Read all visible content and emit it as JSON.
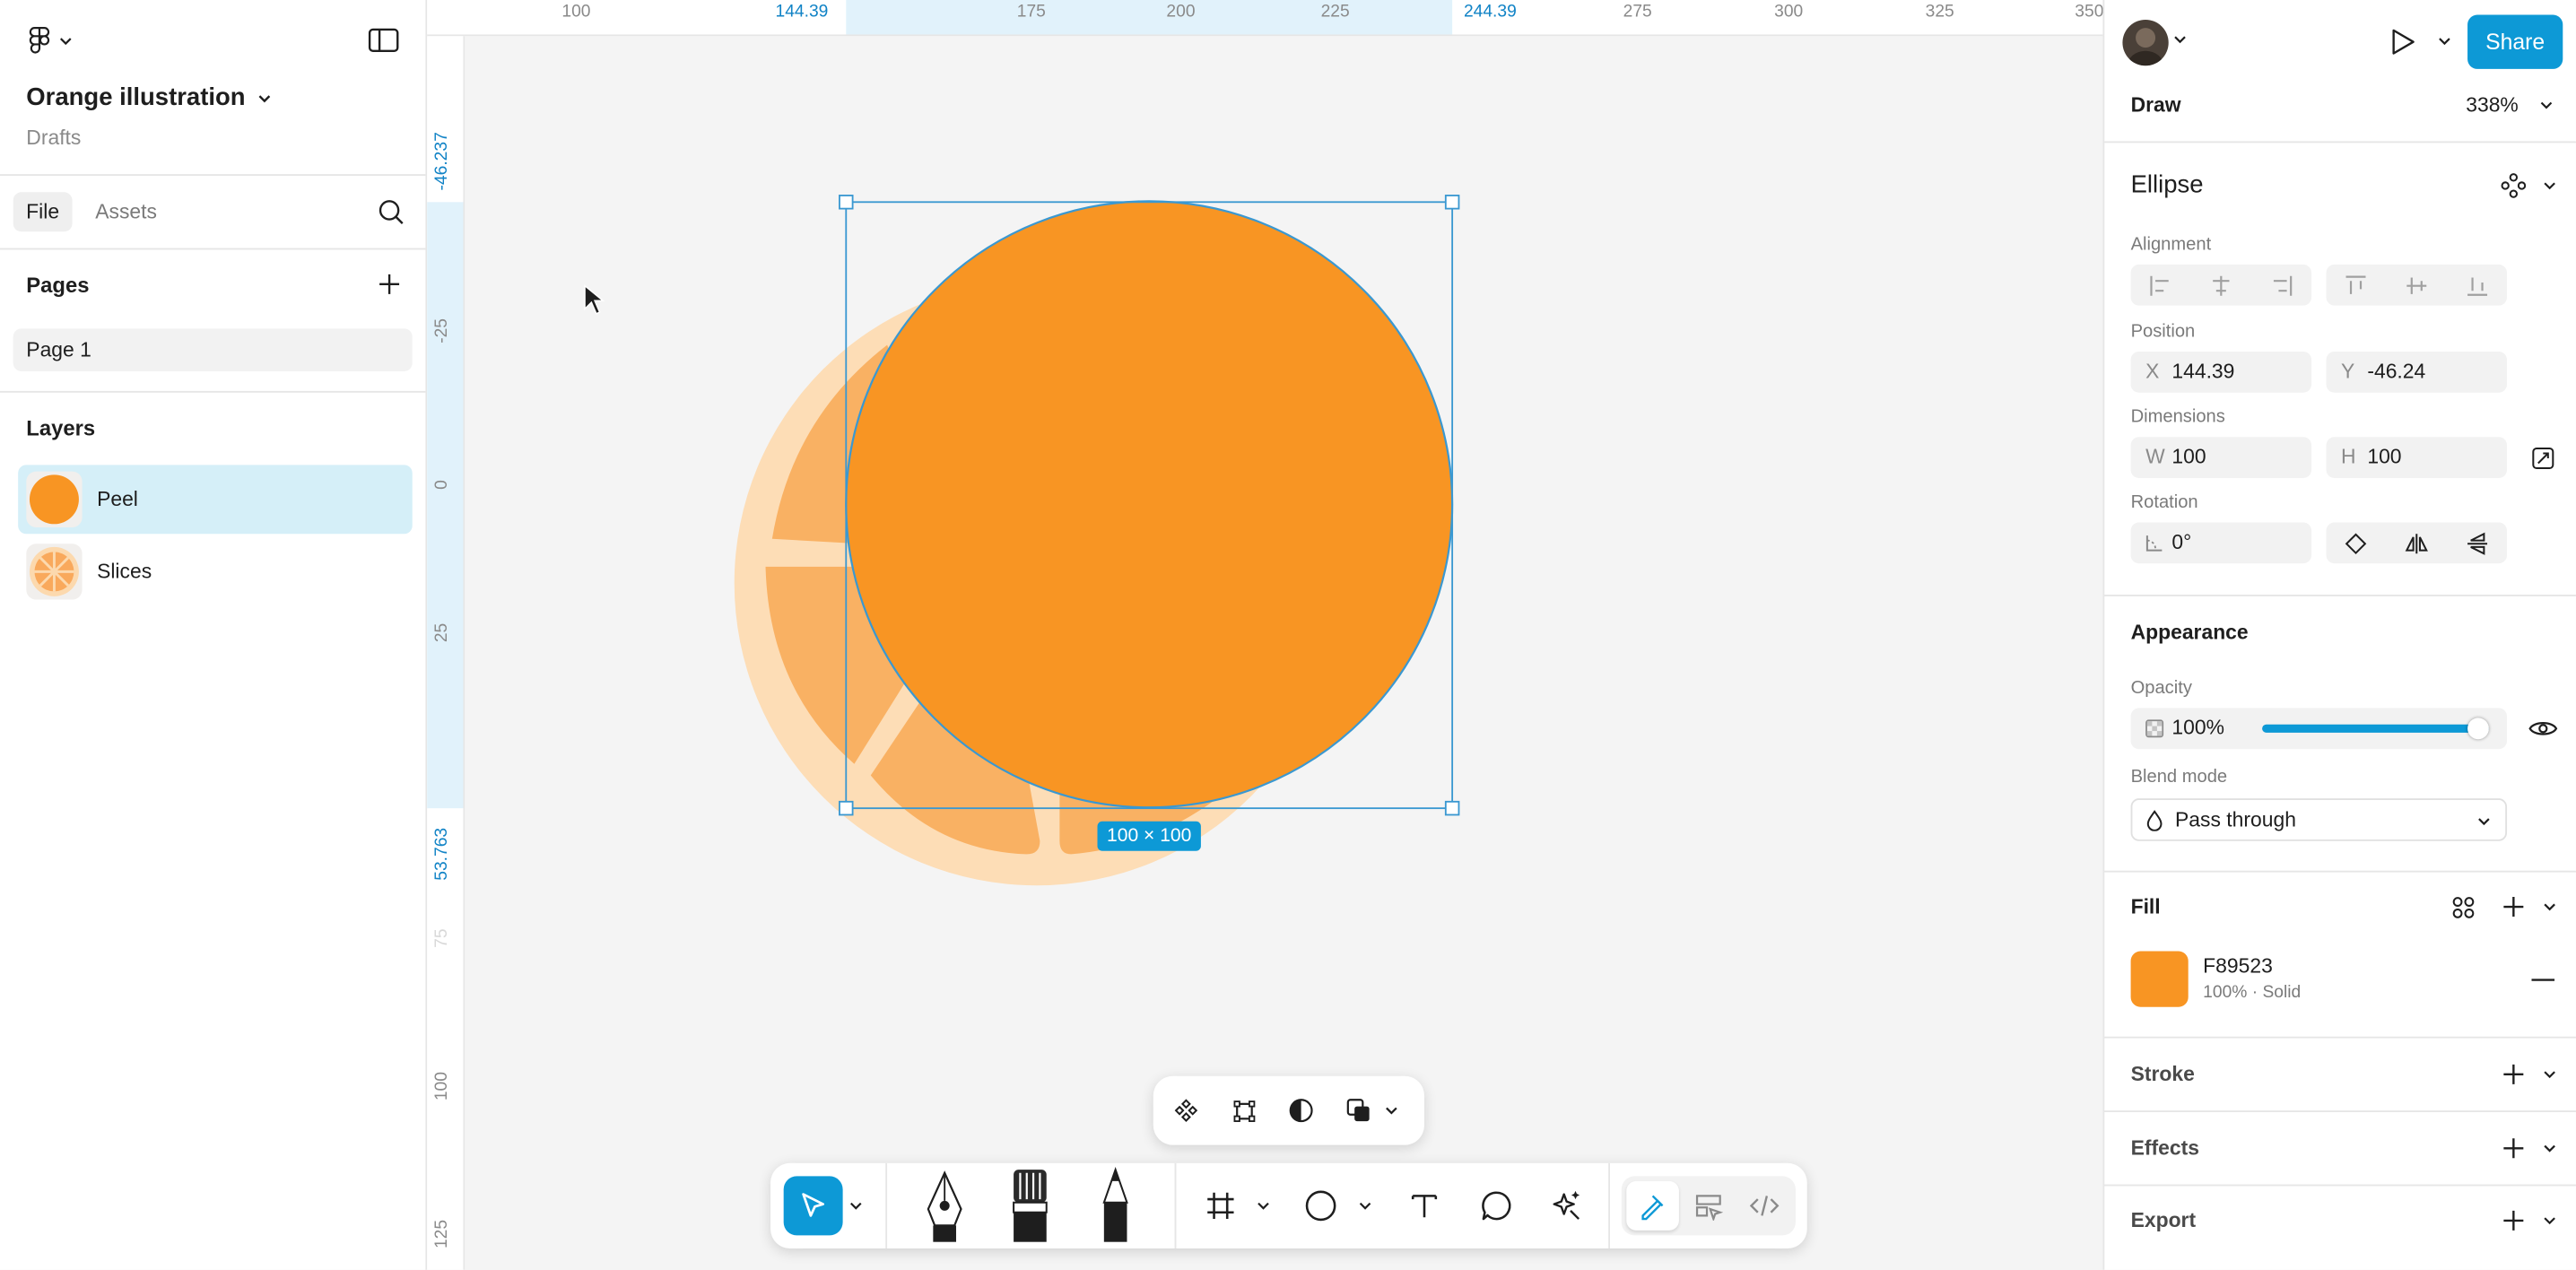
{
  "file": {
    "name": "Orange illustration",
    "location": "Drafts"
  },
  "left_tabs": {
    "file": "File",
    "assets": "Assets"
  },
  "pages": {
    "heading": "Pages",
    "items": [
      "Page 1"
    ]
  },
  "layers": {
    "heading": "Layers",
    "items": [
      {
        "name": "Peel",
        "selected": true
      },
      {
        "name": "Slices",
        "selected": false
      }
    ]
  },
  "rulers": {
    "h_ticks": [
      "100",
      "144.39",
      "175",
      "200",
      "225",
      "244.39",
      "275",
      "300",
      "325",
      "350"
    ],
    "v_ticks": [
      "-46.237",
      "-25",
      "0",
      "25",
      "53.763",
      "75",
      "100",
      "125"
    ]
  },
  "canvas": {
    "size_label": "100 × 100"
  },
  "top_right": {
    "share": "Share"
  },
  "draw": {
    "mode": "Draw",
    "zoom": "338%"
  },
  "props": {
    "element": "Ellipse",
    "alignment_label": "Alignment",
    "position_label": "Position",
    "x_prefix": "X",
    "x": "144.39",
    "y_prefix": "Y",
    "y": "-46.24",
    "dimensions_label": "Dimensions",
    "w_prefix": "W",
    "w": "100",
    "h_prefix": "H",
    "h": "100",
    "rotation_label": "Rotation",
    "rotation": "0°",
    "appearance": "Appearance",
    "opacity_label": "Opacity",
    "opacity": "100%",
    "opacity_value": 1.0,
    "blend_label": "Blend mode",
    "blend": "Pass through",
    "fill_heading": "Fill",
    "fill_hex": "F89523",
    "fill_color": "#F89523",
    "fill_meta": "100% · Solid",
    "stroke": "Stroke",
    "effects": "Effects",
    "export": "Export"
  },
  "colors": {
    "accent": "#0D99D6",
    "orange": "#F89523",
    "selection": "#D5EFF8"
  }
}
